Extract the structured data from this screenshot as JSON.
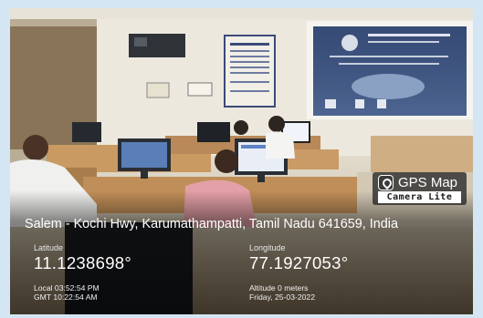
{
  "badge": {
    "icon": "map-pin-icon",
    "title": "GPS Map",
    "subtitle": "Camera Lite"
  },
  "location": {
    "address": "Salem - Kochi Hwy, Karumathampatti, Tamil Nadu 641659, India",
    "latitude_label": "Latitude",
    "latitude_value": "11.1238698°",
    "longitude_label": "Longitude",
    "longitude_value": "77.1927053°",
    "local_time": "Local 03:52:54 PM",
    "gmt_time": "GMT 10:22:54 AM",
    "altitude": "Altitude 0 meters",
    "date": "Friday, 25-03-2022"
  }
}
